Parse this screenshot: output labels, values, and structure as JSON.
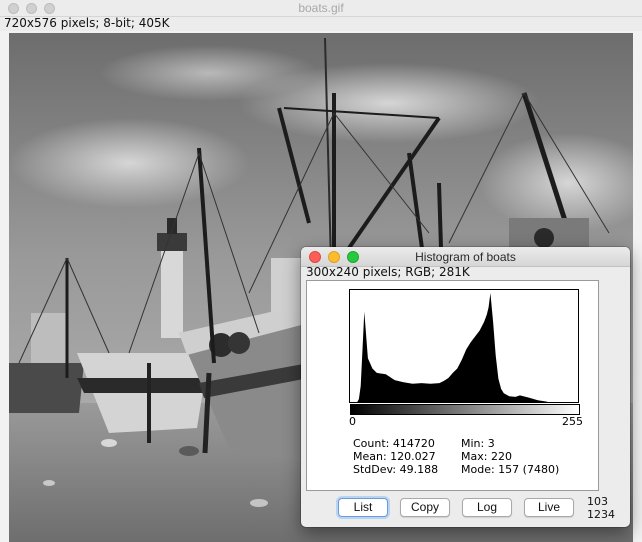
{
  "main_window": {
    "title": "boats.gif",
    "info": "720x576 pixels; 8-bit; 405K"
  },
  "histogram_window": {
    "title": "Histogram of boats",
    "info": "300x240 pixels; RGB; 281K",
    "axis_min": "0",
    "axis_max": "255",
    "stats": {
      "count": "Count: 414720",
      "mean": "Mean: 120.027",
      "stddev": "StdDev: 49.188",
      "min": "Min: 3",
      "max": "Max: 220",
      "mode": "Mode: 157 (7480)"
    },
    "buttons": {
      "list": "List",
      "copy": "Copy",
      "log": "Log",
      "live": "Live"
    },
    "cursor_value": "103",
    "cursor_count": "1234"
  },
  "colors": {
    "close": "#fc5f57",
    "minimize": "#fdbc2e",
    "zoom": "#28c840"
  },
  "chart_data": {
    "type": "area",
    "title": "",
    "xlabel": "",
    "ylabel": "",
    "xlim": [
      0,
      255
    ],
    "x": [
      0,
      3,
      5,
      8,
      10,
      12,
      14,
      16,
      20,
      25,
      30,
      40,
      50,
      60,
      70,
      80,
      90,
      100,
      105,
      110,
      115,
      120,
      125,
      130,
      135,
      140,
      145,
      150,
      153,
      155,
      157,
      160,
      163,
      166,
      169,
      172,
      178,
      185,
      190,
      200,
      210,
      220,
      221,
      255
    ],
    "values": [
      0,
      0,
      0,
      0,
      200,
      1100,
      3600,
      6200,
      3000,
      2300,
      2000,
      1900,
      1500,
      1350,
      1250,
      1300,
      1250,
      1300,
      1450,
      1650,
      2000,
      2300,
      2900,
      3600,
      4100,
      4500,
      4900,
      5500,
      6000,
      6500,
      7480,
      5500,
      3200,
      1600,
      900,
      600,
      400,
      350,
      450,
      300,
      120,
      30,
      0,
      0
    ]
  }
}
